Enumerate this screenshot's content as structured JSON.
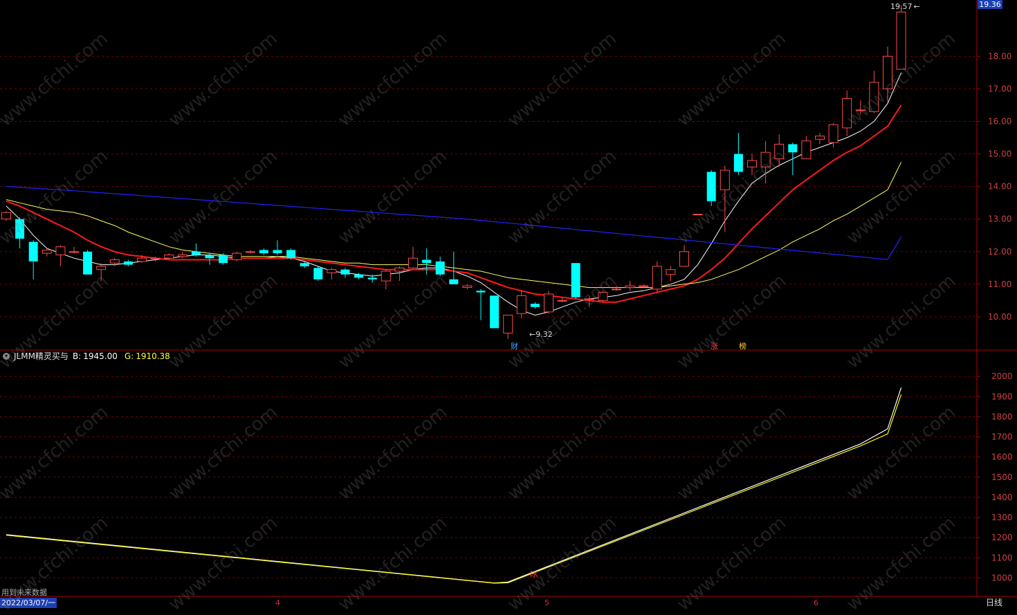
{
  "header": {
    "last_price_tag": "19.36"
  },
  "indicator": {
    "name": "JLMM精灵买与",
    "b_label": "B:",
    "b_value": "1945.00",
    "g_label": "G:",
    "g_value": "1910.38"
  },
  "footer": {
    "date": "2022/03/07/一",
    "period": "日线",
    "note": "用到未来数据",
    "months": [
      "4",
      "5",
      "6"
    ]
  },
  "markers": {
    "high_label": "19.57",
    "low_label": "9.32",
    "tag_cai": "财",
    "tag_zhang": "涨",
    "tag_bang": "榜",
    "buy_tag": "买"
  },
  "watermark": "www.cfchi.com",
  "colors": {
    "up": "#ff4a4a",
    "down": "#00ffff",
    "ma5": "#ffffff",
    "ma10": "#ff1a1a",
    "ma20": "#ffff66",
    "ma60": "#2222ff",
    "grid": "#7a0000",
    "axis": "#b00000",
    "b_line": "#ffffff",
    "g_line": "#ffff00"
  },
  "chart_data": [
    {
      "type": "candlestick",
      "ylim": [
        9.0,
        19.6
      ],
      "yticks": [
        10.0,
        11.0,
        12.0,
        13.0,
        14.0,
        15.0,
        16.0,
        17.0,
        18.0
      ],
      "candles": [
        {
          "o": 13.0,
          "c": 13.2,
          "h": 13.25,
          "l": 12.95
        },
        {
          "o": 13.0,
          "c": 12.4,
          "h": 13.05,
          "l": 12.1
        },
        {
          "o": 12.3,
          "c": 11.7,
          "h": 12.35,
          "l": 11.15
        },
        {
          "o": 11.95,
          "c": 12.05,
          "h": 12.1,
          "l": 11.85
        },
        {
          "o": 11.9,
          "c": 12.15,
          "h": 12.2,
          "l": 11.55
        },
        {
          "o": 12.0,
          "c": 12.0,
          "h": 12.15,
          "l": 11.95
        },
        {
          "o": 12.0,
          "c": 11.3,
          "h": 12.05,
          "l": 11.3
        },
        {
          "o": 11.45,
          "c": 11.55,
          "h": 11.65,
          "l": 11.1
        },
        {
          "o": 11.65,
          "c": 11.75,
          "h": 11.8,
          "l": 11.55
        },
        {
          "o": 11.7,
          "c": 11.6,
          "h": 11.75,
          "l": 11.55
        },
        {
          "o": 11.7,
          "c": 11.8,
          "h": 11.9,
          "l": 11.65
        },
        {
          "o": 11.8,
          "c": 11.8,
          "h": 11.85,
          "l": 11.7
        },
        {
          "o": 11.8,
          "c": 11.9,
          "h": 11.95,
          "l": 11.75
        },
        {
          "o": 11.85,
          "c": 11.9,
          "h": 12.0,
          "l": 11.8
        },
        {
          "o": 12.0,
          "c": 11.9,
          "h": 12.25,
          "l": 11.85
        },
        {
          "o": 11.9,
          "c": 11.8,
          "h": 11.95,
          "l": 11.6
        },
        {
          "o": 11.9,
          "c": 11.65,
          "h": 11.95,
          "l": 11.6
        },
        {
          "o": 11.75,
          "c": 11.95,
          "h": 12.0,
          "l": 11.7
        },
        {
          "o": 12.0,
          "c": 12.0,
          "h": 12.05,
          "l": 11.95
        },
        {
          "o": 12.05,
          "c": 11.95,
          "h": 12.1,
          "l": 11.9
        },
        {
          "o": 12.05,
          "c": 11.95,
          "h": 12.35,
          "l": 11.9
        },
        {
          "o": 12.05,
          "c": 11.8,
          "h": 12.1,
          "l": 11.75
        },
        {
          "o": 11.65,
          "c": 11.55,
          "h": 11.7,
          "l": 11.5
        },
        {
          "o": 11.5,
          "c": 11.15,
          "h": 11.55,
          "l": 11.1
        },
        {
          "o": 11.35,
          "c": 11.45,
          "h": 11.5,
          "l": 11.15
        },
        {
          "o": 11.45,
          "c": 11.3,
          "h": 11.5,
          "l": 11.2
        },
        {
          "o": 11.3,
          "c": 11.2,
          "h": 11.35,
          "l": 11.15
        },
        {
          "o": 11.2,
          "c": 11.15,
          "h": 11.3,
          "l": 11.05
        },
        {
          "o": 11.1,
          "c": 11.4,
          "h": 11.45,
          "l": 10.85
        },
        {
          "o": 11.4,
          "c": 11.5,
          "h": 11.55,
          "l": 11.1
        },
        {
          "o": 11.5,
          "c": 11.8,
          "h": 12.15,
          "l": 11.45
        },
        {
          "o": 11.75,
          "c": 11.65,
          "h": 12.1,
          "l": 11.3
        },
        {
          "o": 11.7,
          "c": 11.3,
          "h": 11.85,
          "l": 11.25
        },
        {
          "o": 11.15,
          "c": 11.0,
          "h": 12.0,
          "l": 11.0
        },
        {
          "o": 10.9,
          "c": 10.95,
          "h": 11.0,
          "l": 10.85
        },
        {
          "o": 10.8,
          "c": 10.75,
          "h": 10.85,
          "l": 9.9
        },
        {
          "o": 10.65,
          "c": 9.65,
          "h": 10.65,
          "l": 9.65
        },
        {
          "o": 9.5,
          "c": 10.05,
          "h": 10.05,
          "l": 9.32
        },
        {
          "o": 10.1,
          "c": 10.65,
          "h": 10.8,
          "l": 9.95
        },
        {
          "o": 10.4,
          "c": 10.3,
          "h": 10.45,
          "l": 10.25
        },
        {
          "o": 10.15,
          "c": 10.7,
          "h": 10.8,
          "l": 10.1
        },
        {
          "o": 10.5,
          "c": 10.5,
          "h": 10.6,
          "l": 10.45
        },
        {
          "o": 11.65,
          "c": 10.6,
          "h": 11.65,
          "l": 10.55
        },
        {
          "o": 10.55,
          "c": 10.55,
          "h": 10.65,
          "l": 10.3
        },
        {
          "o": 10.5,
          "c": 10.75,
          "h": 10.8,
          "l": 10.45
        },
        {
          "o": 10.85,
          "c": 10.85,
          "h": 10.95,
          "l": 10.8
        },
        {
          "o": 10.9,
          "c": 10.95,
          "h": 11.1,
          "l": 10.8
        },
        {
          "o": 10.95,
          "c": 10.95,
          "h": 11.0,
          "l": 10.9
        },
        {
          "o": 10.85,
          "c": 11.55,
          "h": 11.7,
          "l": 10.75
        },
        {
          "o": 11.3,
          "c": 11.45,
          "h": 11.55,
          "l": 11.1
        },
        {
          "o": 11.55,
          "c": 12.0,
          "h": 12.2,
          "l": 11.55
        },
        {
          "o": 13.15,
          "c": 13.15,
          "h": 13.15,
          "l": 13.15
        },
        {
          "o": 14.45,
          "c": 13.55,
          "h": 14.5,
          "l": 13.4
        },
        {
          "o": 13.9,
          "c": 14.5,
          "h": 14.65,
          "l": 12.6
        },
        {
          "o": 15.0,
          "c": 14.45,
          "h": 15.65,
          "l": 14.35
        },
        {
          "o": 14.6,
          "c": 14.8,
          "h": 15.0,
          "l": 14.35
        },
        {
          "o": 14.6,
          "c": 15.05,
          "h": 15.4,
          "l": 14.1
        },
        {
          "o": 14.85,
          "c": 15.3,
          "h": 15.6,
          "l": 14.6
        },
        {
          "o": 15.3,
          "c": 15.05,
          "h": 15.35,
          "l": 14.35
        },
        {
          "o": 14.85,
          "c": 15.4,
          "h": 15.55,
          "l": 14.85
        },
        {
          "o": 15.45,
          "c": 15.55,
          "h": 15.65,
          "l": 15.3
        },
        {
          "o": 15.35,
          "c": 15.9,
          "h": 15.95,
          "l": 15.2
        },
        {
          "o": 15.8,
          "c": 16.7,
          "h": 16.95,
          "l": 15.55
        },
        {
          "o": 16.35,
          "c": 16.35,
          "h": 16.65,
          "l": 16.2
        },
        {
          "o": 16.3,
          "c": 17.2,
          "h": 17.55,
          "l": 16.25
        },
        {
          "o": 17.0,
          "c": 18.0,
          "h": 18.3,
          "l": 16.6
        },
        {
          "o": 17.6,
          "c": 19.36,
          "h": 19.57,
          "l": 17.6
        }
      ],
      "ma_lines": [
        {
          "name": "MA5",
          "values": [
            13.4,
            13.0,
            12.5,
            12.1,
            11.95,
            11.8,
            11.7,
            11.6,
            11.6,
            11.65,
            11.7,
            11.75,
            11.8,
            11.85,
            11.9,
            11.9,
            11.85,
            11.8,
            11.8,
            11.8,
            11.85,
            11.8,
            11.7,
            11.55,
            11.4,
            11.35,
            11.3,
            11.25,
            11.3,
            11.35,
            11.45,
            11.5,
            11.5,
            11.4,
            11.25,
            11.05,
            10.75,
            10.45,
            10.2,
            10.05,
            10.15,
            10.3,
            10.45,
            10.55,
            10.6,
            10.65,
            10.75,
            10.8,
            10.9,
            11.0,
            11.15,
            11.6,
            12.25,
            12.95,
            13.55,
            14.1,
            14.4,
            14.65,
            14.85,
            15.05,
            15.2,
            15.35,
            15.5,
            15.7,
            16.0,
            16.55,
            17.5
          ]
        },
        {
          "name": "MA10",
          "values": [
            13.55,
            13.4,
            13.2,
            13.0,
            12.8,
            12.6,
            12.35,
            12.15,
            12.0,
            11.9,
            11.85,
            11.8,
            11.75,
            11.75,
            11.75,
            11.75,
            11.75,
            11.8,
            11.8,
            11.8,
            11.8,
            11.8,
            11.75,
            11.7,
            11.65,
            11.6,
            11.55,
            11.5,
            11.45,
            11.45,
            11.45,
            11.45,
            11.45,
            11.4,
            11.35,
            11.2,
            11.05,
            10.9,
            10.8,
            10.7,
            10.65,
            10.6,
            10.55,
            10.5,
            10.45,
            10.45,
            10.55,
            10.65,
            10.75,
            10.85,
            10.95,
            11.15,
            11.45,
            11.8,
            12.25,
            12.7,
            13.1,
            13.5,
            13.9,
            14.2,
            14.5,
            14.8,
            15.05,
            15.25,
            15.55,
            15.85,
            16.5
          ]
        },
        {
          "name": "MA20",
          "values": [
            13.6,
            13.5,
            13.4,
            13.3,
            13.25,
            13.2,
            13.1,
            12.95,
            12.8,
            12.6,
            12.45,
            12.3,
            12.15,
            12.05,
            12.0,
            11.95,
            11.9,
            11.85,
            11.85,
            11.85,
            11.85,
            11.85,
            11.8,
            11.75,
            11.7,
            11.65,
            11.65,
            11.6,
            11.6,
            11.6,
            11.6,
            11.6,
            11.55,
            11.5,
            11.45,
            11.4,
            11.3,
            11.2,
            11.15,
            11.1,
            11.05,
            11.0,
            10.95,
            10.9,
            10.9,
            10.9,
            10.9,
            10.9,
            10.9,
            10.95,
            11.0,
            11.05,
            11.15,
            11.3,
            11.45,
            11.65,
            11.85,
            12.05,
            12.3,
            12.5,
            12.7,
            12.95,
            13.15,
            13.4,
            13.65,
            13.9,
            14.75
          ]
        },
        {
          "name": "MA60",
          "values": [
            14.0,
            13.98,
            13.95,
            13.92,
            13.9,
            13.87,
            13.84,
            13.81,
            13.78,
            13.75,
            13.72,
            13.69,
            13.66,
            13.63,
            13.6,
            13.57,
            13.54,
            13.51,
            13.48,
            13.45,
            13.42,
            13.39,
            13.36,
            13.33,
            13.3,
            13.27,
            13.24,
            13.21,
            13.18,
            13.15,
            13.12,
            13.09,
            13.06,
            13.03,
            13.0,
            12.96,
            12.92,
            12.88,
            12.84,
            12.8,
            12.76,
            12.72,
            12.68,
            12.64,
            12.6,
            12.56,
            12.52,
            12.48,
            12.44,
            12.4,
            12.36,
            12.32,
            12.28,
            12.24,
            12.2,
            12.16,
            12.12,
            12.08,
            12.04,
            12.0,
            11.96,
            11.92,
            11.88,
            11.84,
            11.8,
            11.76,
            12.45
          ]
        }
      ]
    },
    {
      "type": "line",
      "title": "JLMM精灵买与",
      "ylim": [
        950,
        2100
      ],
      "yticks": [
        1000,
        1100,
        1200,
        1300,
        1400,
        1500,
        1600,
        1700,
        1800,
        1900,
        2000
      ],
      "x": [
        0,
        36,
        37,
        63,
        65,
        66
      ],
      "series": [
        {
          "name": "B",
          "values": [
            1215,
            975,
            980,
            1665,
            1740,
            1945
          ]
        },
        {
          "name": "G",
          "values": [
            1212,
            974,
            976,
            1655,
            1715,
            1910.38
          ]
        }
      ]
    }
  ]
}
